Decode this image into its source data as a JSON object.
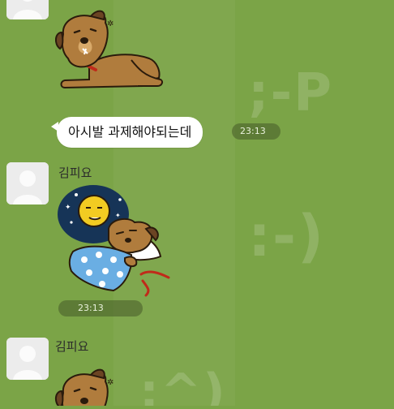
{
  "chat": {
    "messages": [
      {
        "sender": "",
        "type": "sticker",
        "sticker": "dog-lying-exhausted-sticker"
      },
      {
        "sender": "",
        "type": "text",
        "text": "아시발 과제해야되는데",
        "time": "23:13"
      },
      {
        "sender": "김피요",
        "type": "sticker",
        "sticker": "dog-sleeping-under-blanket-sticker",
        "time": "23:13"
      },
      {
        "sender": "김피요",
        "type": "sticker",
        "sticker": "dog-lying-exhausted-sticker"
      }
    ]
  },
  "background": {
    "emoticons": [
      ";-P",
      ":-)",
      ":^)"
    ],
    "color": "#7ba447"
  },
  "colors": {
    "bubble": "#ffffff",
    "time_pill": "#4e6a2c"
  }
}
